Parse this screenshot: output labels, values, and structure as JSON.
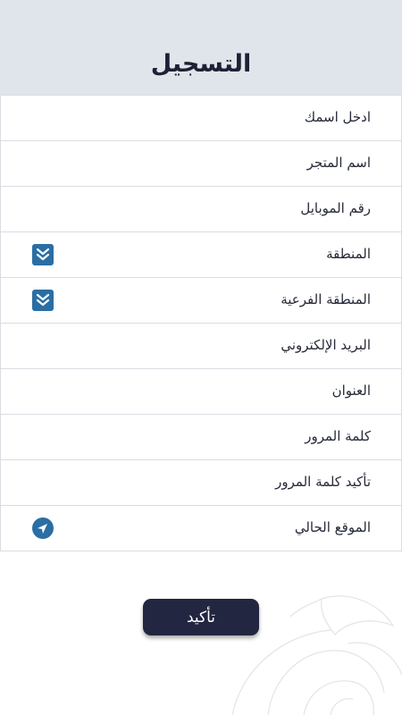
{
  "header": {
    "title": "التسجيل"
  },
  "form": {
    "fields": [
      {
        "label": "ادخل اسمك"
      },
      {
        "label": "اسم المتجر"
      },
      {
        "label": "رقم الموبايل"
      },
      {
        "label": "المنطقة",
        "icon": "double-chevron-down-icon"
      },
      {
        "label": "المنطقة الفرعية",
        "icon": "double-chevron-down-icon"
      },
      {
        "label": "البريد الإلكتروني"
      },
      {
        "label": "العنوان"
      },
      {
        "label": "كلمة المرور"
      },
      {
        "label": "تأكيد كلمة المرور"
      },
      {
        "label": "الموقع الحالي",
        "icon": "location-arrow-icon"
      }
    ]
  },
  "actions": {
    "confirm_label": "تأكيد"
  },
  "colors": {
    "accent": "#2b6ea4",
    "header_bg": "#dfe5ea",
    "button_bg": "#222641"
  }
}
